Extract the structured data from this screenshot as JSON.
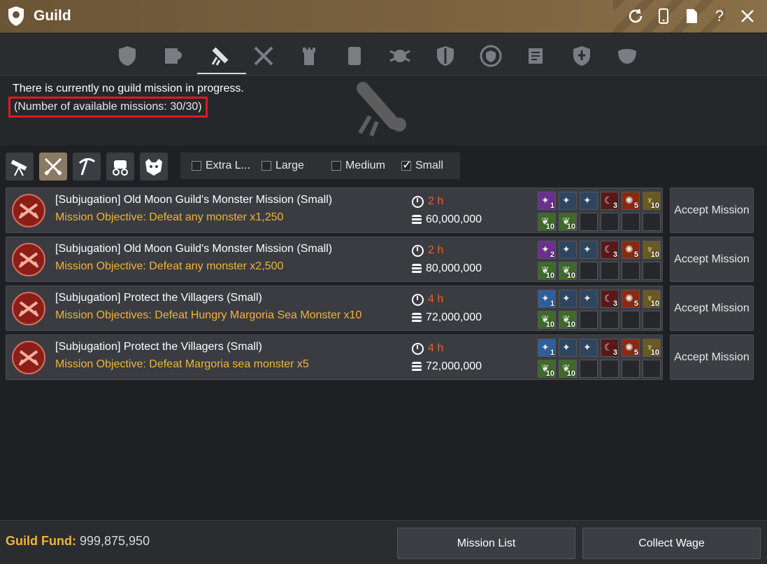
{
  "window": {
    "title": "Guild",
    "actions": [
      "refresh-icon",
      "mobile-icon",
      "document-icon",
      "help-icon",
      "close-icon"
    ]
  },
  "tabs": [
    {
      "name": "guild-info-icon",
      "active": false
    },
    {
      "name": "members-icon",
      "active": false
    },
    {
      "name": "mission-scroll-icon",
      "active": true
    },
    {
      "name": "war-icon",
      "active": false
    },
    {
      "name": "tower-icon",
      "active": false
    },
    {
      "name": "notice-icon",
      "active": false
    },
    {
      "name": "crest-icon",
      "active": false
    },
    {
      "name": "shield-icon",
      "active": false
    },
    {
      "name": "emblem-icon",
      "active": false
    },
    {
      "name": "records-icon",
      "active": false
    },
    {
      "name": "fleur-shield-icon",
      "active": false
    },
    {
      "name": "mask-icon",
      "active": false
    }
  ],
  "status": {
    "line1": "There is currently no guild mission in progress.",
    "line2": "(Number of available missions: 30/30)"
  },
  "filters": {
    "types": [
      {
        "name": "telescope-icon",
        "active": false
      },
      {
        "name": "crossed-swords-icon",
        "active": true
      },
      {
        "name": "pickaxe-icon",
        "active": false
      },
      {
        "name": "carriage-icon",
        "active": false
      },
      {
        "name": "monster-icon",
        "active": false
      }
    ],
    "sizes": [
      {
        "label": "Extra L...",
        "checked": false
      },
      {
        "label": "Large",
        "checked": false
      },
      {
        "label": "Medium",
        "checked": false
      },
      {
        "label": "Small",
        "checked": true
      }
    ]
  },
  "missions": [
    {
      "title": "[Subjugation] Old Moon Guild's Monster Mission (Small)",
      "objective_prefix": "Mission Objective: Defeat any monster x",
      "objective_count": "1,250",
      "time": "2 h",
      "fund": "60,000,000",
      "rewards": [
        {
          "type": "purple",
          "qty": "1"
        },
        {
          "type": "exp",
          "qty": ""
        },
        {
          "type": "exp",
          "qty": ""
        },
        {
          "type": "moon",
          "qty": "3"
        },
        {
          "type": "orb",
          "qty": "5"
        },
        {
          "type": "cup",
          "qty": "10"
        },
        {
          "type": "green",
          "qty": "10"
        },
        {
          "type": "green",
          "qty": "10"
        }
      ],
      "accept_label": "Accept Mission"
    },
    {
      "title": "[Subjugation] Old Moon Guild's Monster Mission (Small)",
      "objective_prefix": "Mission Objective: Defeat any monster x",
      "objective_count": "2,500",
      "time": "2 h",
      "fund": "80,000,000",
      "rewards": [
        {
          "type": "purple",
          "qty": "2"
        },
        {
          "type": "exp",
          "qty": ""
        },
        {
          "type": "exp",
          "qty": ""
        },
        {
          "type": "moon",
          "qty": "3"
        },
        {
          "type": "orb",
          "qty": "5"
        },
        {
          "type": "cup",
          "qty": "10"
        },
        {
          "type": "green",
          "qty": "10"
        },
        {
          "type": "green",
          "qty": "10"
        }
      ],
      "accept_label": "Accept Mission"
    },
    {
      "title": "[Subjugation] Protect the Villagers (Small)",
      "objective_prefix": "Mission Objectives: Defeat Hungry Margoria Sea Monster x",
      "objective_count": "10",
      "time": "4 h",
      "fund": "72,000,000",
      "rewards": [
        {
          "type": "blue",
          "qty": "1"
        },
        {
          "type": "exp",
          "qty": ""
        },
        {
          "type": "exp",
          "qty": ""
        },
        {
          "type": "moon",
          "qty": "3"
        },
        {
          "type": "orb",
          "qty": "5"
        },
        {
          "type": "cup",
          "qty": "10"
        },
        {
          "type": "green",
          "qty": "10"
        },
        {
          "type": "green",
          "qty": "10"
        }
      ],
      "accept_label": "Accept Mission"
    },
    {
      "title": "[Subjugation] Protect the Villagers (Small)",
      "objective_prefix": "Mission Objective: Defeat Margoria sea monster x",
      "objective_count": "5",
      "time": "4 h",
      "fund": "72,000,000",
      "rewards": [
        {
          "type": "blue",
          "qty": "1"
        },
        {
          "type": "exp",
          "qty": ""
        },
        {
          "type": "exp",
          "qty": ""
        },
        {
          "type": "moon",
          "qty": "3"
        },
        {
          "type": "orb",
          "qty": "5"
        },
        {
          "type": "cup",
          "qty": "10"
        },
        {
          "type": "green",
          "qty": "10"
        },
        {
          "type": "green",
          "qty": "10"
        }
      ],
      "accept_label": "Accept Mission"
    }
  ],
  "footer": {
    "fund_label": "Guild Fund:",
    "fund_value": "999,875,950",
    "mission_list": "Mission List",
    "collect_wage": "Collect Wage"
  },
  "colors": {
    "accent_gold": "#f2b33a",
    "time_red": "#e8602c",
    "highlight_box": "#e01a22",
    "titlebar": "#7a6240"
  }
}
